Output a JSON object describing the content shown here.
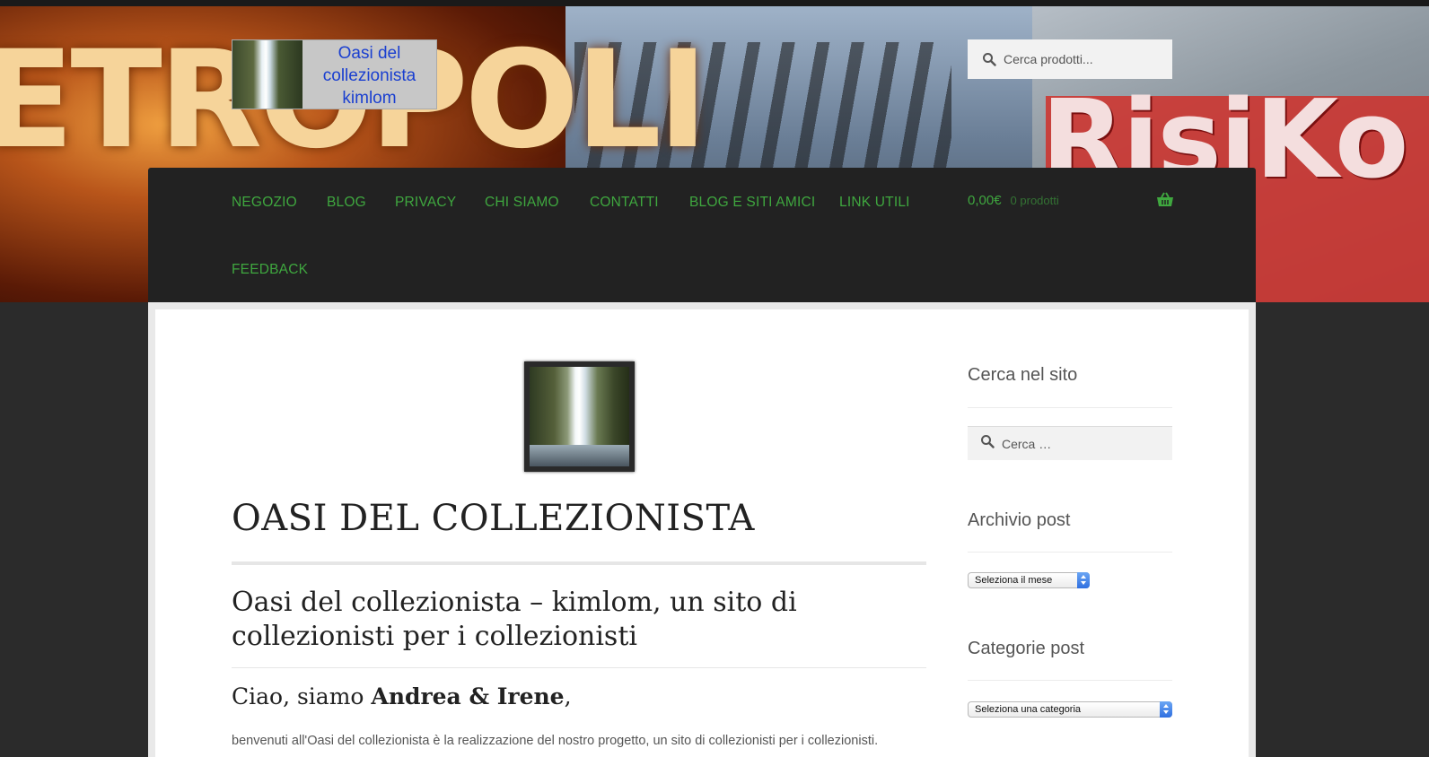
{
  "header": {
    "banner_text_left": "ETROPOLI",
    "banner_text_right": "RisiKo",
    "logo": {
      "line1": "Oasi del",
      "line2": "collezionista",
      "line3": "kimlom"
    },
    "search": {
      "placeholder": "Cerca prodotti..."
    }
  },
  "nav": {
    "items": [
      "NEGOZIO",
      "BLOG",
      "PRIVACY",
      "CHI SIAMO",
      "CONTATTI",
      "BLOG E SITI AMICI",
      "LINK UTILI",
      "FEEDBACK"
    ],
    "cart": {
      "amount": "0,00€",
      "count": "0 prodotti"
    },
    "accent_color": "#3fa73f"
  },
  "content": {
    "title": "OASI DEL COLLEZIONISTA",
    "subtitle": "Oasi del collezionista – kimlom, un sito di collezionisti per i collezionisti",
    "greeting_prefix": "Ciao, siamo ",
    "greeting_names": "Andrea & Irene",
    "greeting_suffix": ",",
    "paragraph": "benvenuti all'Oasi del collezionista è la realizzazione del nostro progetto, un sito di collezionisti per i collezionisti."
  },
  "sidebar": {
    "search_title": "Cerca nel sito",
    "search_placeholder": "Cerca …",
    "archive_title": "Archivio post",
    "archive_select": "Seleziona il mese",
    "categories_title": "Categorie post",
    "categories_select": "Seleziona una categoria"
  },
  "icons": [
    "search-icon",
    "basket-icon",
    "select-arrows-icon"
  ]
}
